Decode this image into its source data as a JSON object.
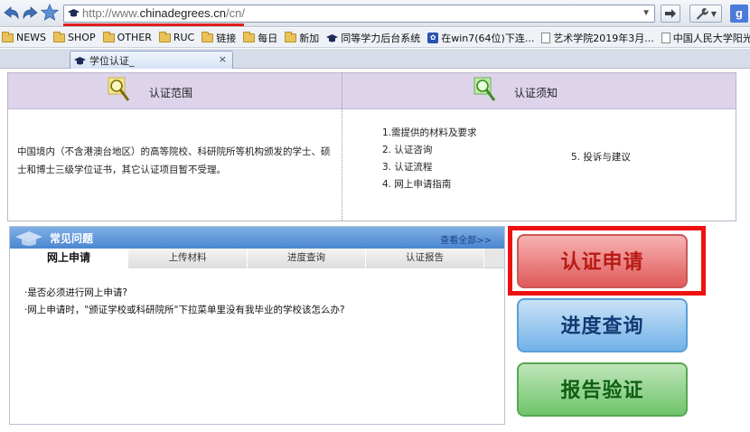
{
  "browser": {
    "url_prefix": "http://www.",
    "url_host": "chinadegrees.cn",
    "url_suffix": "/cn/",
    "google_label": "g",
    "bookmarks": [
      {
        "icon": "folder-icon",
        "label": "NEWS"
      },
      {
        "icon": "folder-icon",
        "label": "SHOP"
      },
      {
        "icon": "folder-icon",
        "label": "OTHER"
      },
      {
        "icon": "folder-icon",
        "label": "RUC"
      },
      {
        "icon": "folder-icon",
        "label": "链接"
      },
      {
        "icon": "folder-icon",
        "label": "每日"
      },
      {
        "icon": "folder-icon",
        "label": "新加"
      },
      {
        "icon": "graduation-cap-icon",
        "label": "同等学力后台系统"
      },
      {
        "icon": "paw-icon",
        "label": "在win7(64位)下连..."
      },
      {
        "icon": "page-icon",
        "label": "艺术学院2019年3月..."
      },
      {
        "icon": "page-icon",
        "label": "中国人民大学阳光招..."
      }
    ],
    "tab_title": "学位认证_",
    "tab_close": "×"
  },
  "scope": {
    "title": "认证范围",
    "text": "中国境内（不含港澳台地区）的高等院校、科研院所等机构颁发的学士、硕士和博士三级学位证书，其它认证项目暂不受理。"
  },
  "notice": {
    "title": "认证须知",
    "items": [
      "1.需提供的材料及要求",
      "2. 认证咨询",
      "3. 认证流程",
      "4. 网上申请指南"
    ],
    "extra": "5. 投诉与建议"
  },
  "faq": {
    "title": "常见问题",
    "more": "查看全部>>",
    "tabs": [
      "网上申请",
      "上传材料",
      "进度查询",
      "认证报告"
    ],
    "questions": [
      "·是否必须进行网上申请?",
      "·网上申请时，\"颁证学校或科研院所\"下拉菜单里没有我毕业的学校该怎么办?"
    ]
  },
  "actions": {
    "apply": "认证申请",
    "progress": "进度查询",
    "verify": "报告验证"
  }
}
